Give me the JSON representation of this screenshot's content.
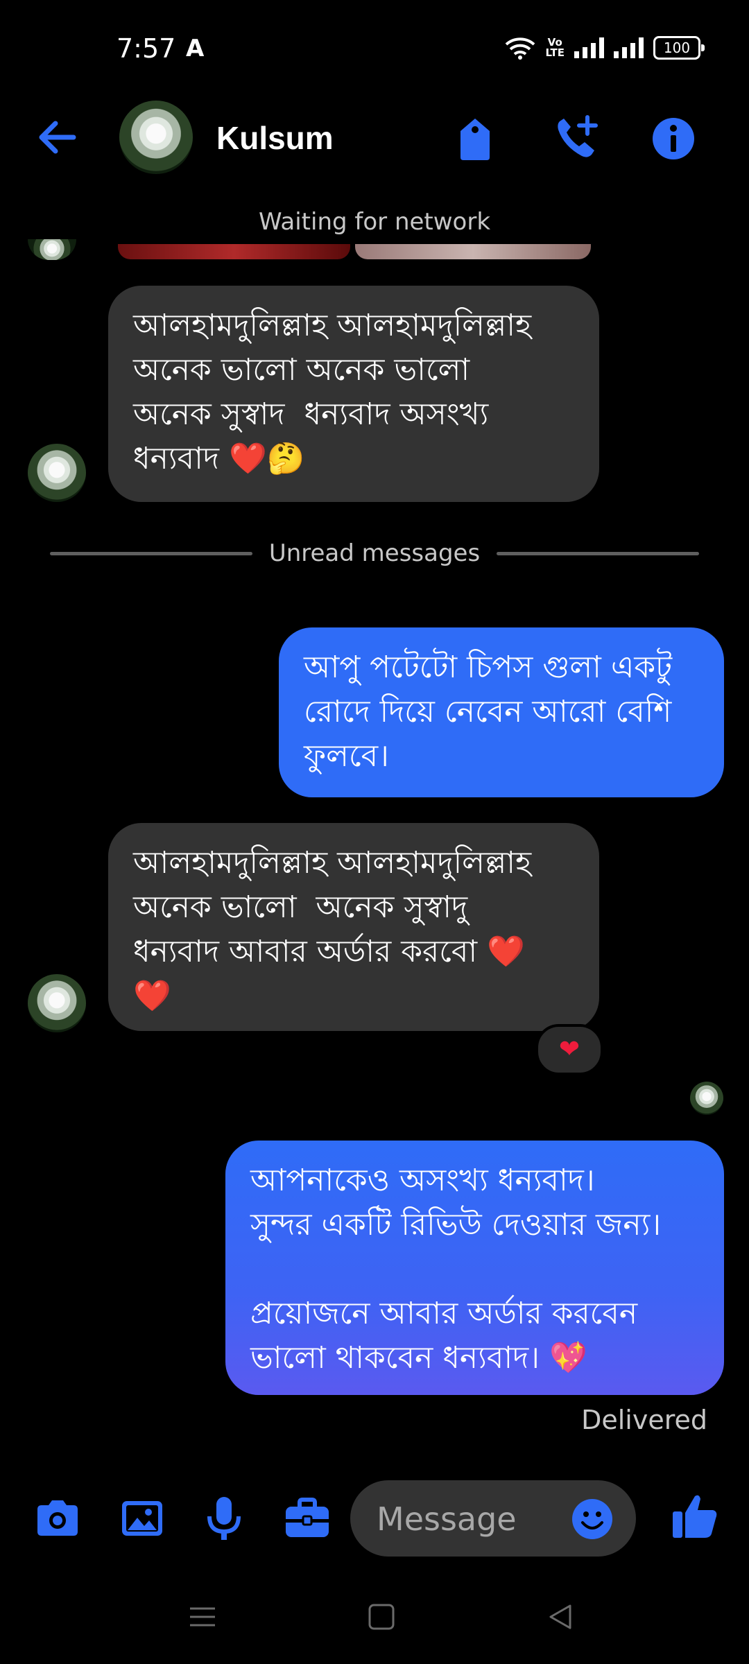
{
  "status_bar": {
    "time": "7:57",
    "app_indicator": "A",
    "network_label": "Vo\nLTE",
    "battery": "100"
  },
  "header": {
    "contact_name": "Kulsum",
    "icons": [
      "back-arrow-icon",
      "tag-icon",
      "call-add-icon",
      "info-icon"
    ],
    "accent_color": "#2f6cf7"
  },
  "network_status": "Waiting for network",
  "messages": [
    {
      "direction": "incoming",
      "text": "আলহামদুলিল্লাহ আলহামদুলিল্লাহ\nঅনেক ভালো অনেক ভালো\nঅনেক সুস্বাদ  ধন্যবাদ অসংখ্য\nধন্যবাদ ❤️🤔"
    },
    {
      "direction": "outgoing",
      "text": "আপু পটেটো চিপস গুলা একটু\nরোদে দিয়ে নেবেন আরো বেশি\nফুলবে।"
    },
    {
      "direction": "incoming",
      "text": "আলহামদুলিল্লাহ আলহামদুলিল্লাহ\nঅনেক ভালো  অনেক সুস্বাদু\nধন্যবাদ আবার অর্ডার করবো ❤️\n❤️",
      "reaction": "❤"
    },
    {
      "direction": "outgoing",
      "text": "আপনাকেও অসংখ্য ধন্যবাদ।\nসুন্দর একটি রিভিউ দেওয়ার জন্য।\n\nপ্রয়োজনে আবার অর্ডার করবেন\nভালো থাকবেন ধন্যবাদ। 💖"
    }
  ],
  "divider_label": "Unread messages",
  "delivered_label": "Delivered",
  "composer": {
    "placeholder": "Message",
    "icons": [
      "camera-icon",
      "image-icon",
      "microphone-icon",
      "briefcase-icon",
      "emoji-icon",
      "thumbs-up-icon"
    ]
  },
  "colors": {
    "incoming_bubble": "#333333",
    "outgoing_bubble": "#2f6cf7",
    "background": "#000000"
  }
}
